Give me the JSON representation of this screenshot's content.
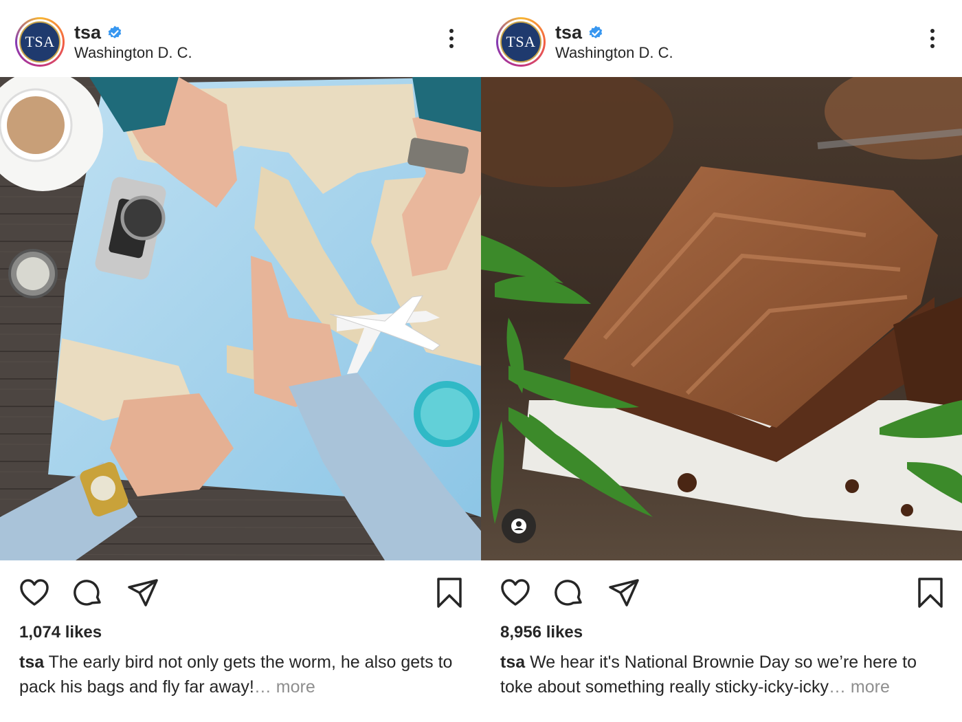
{
  "colors": {
    "text": "#262626",
    "muted": "#8e8e8e",
    "verified": "#3897f0",
    "seal_blue": "#1f3a6e"
  },
  "posts": [
    {
      "username": "tsa",
      "location": "Washington D. C.",
      "avatar_text": "TSA",
      "likes": "1,074 likes",
      "caption_user": "tsa",
      "caption_text": " The early bird not only gets the worm, he also gets to pack his bags and fly far away!",
      "caption_more": "… more",
      "image_alt": "hands pointing at a map of Italy with a camera, coffee cup, compass and toy airplane"
    },
    {
      "username": "tsa",
      "location": "Washington D. C.",
      "avatar_text": "TSA",
      "likes": "8,956 likes",
      "caption_user": "tsa",
      "caption_text": " We hear it's National Brownie Day so we’re here to toke about something really sticky-icky-icky",
      "caption_more": "… more",
      "image_alt": "frosted chocolate brownie with cannabis leaves on parchment paper"
    }
  ],
  "icons": {
    "verified": "verified-badge-icon",
    "more": "more-options-icon",
    "like": "heart-icon",
    "comment": "comment-bubble-icon",
    "share": "paper-plane-icon",
    "save": "bookmark-icon",
    "tag": "user-tag-icon"
  }
}
